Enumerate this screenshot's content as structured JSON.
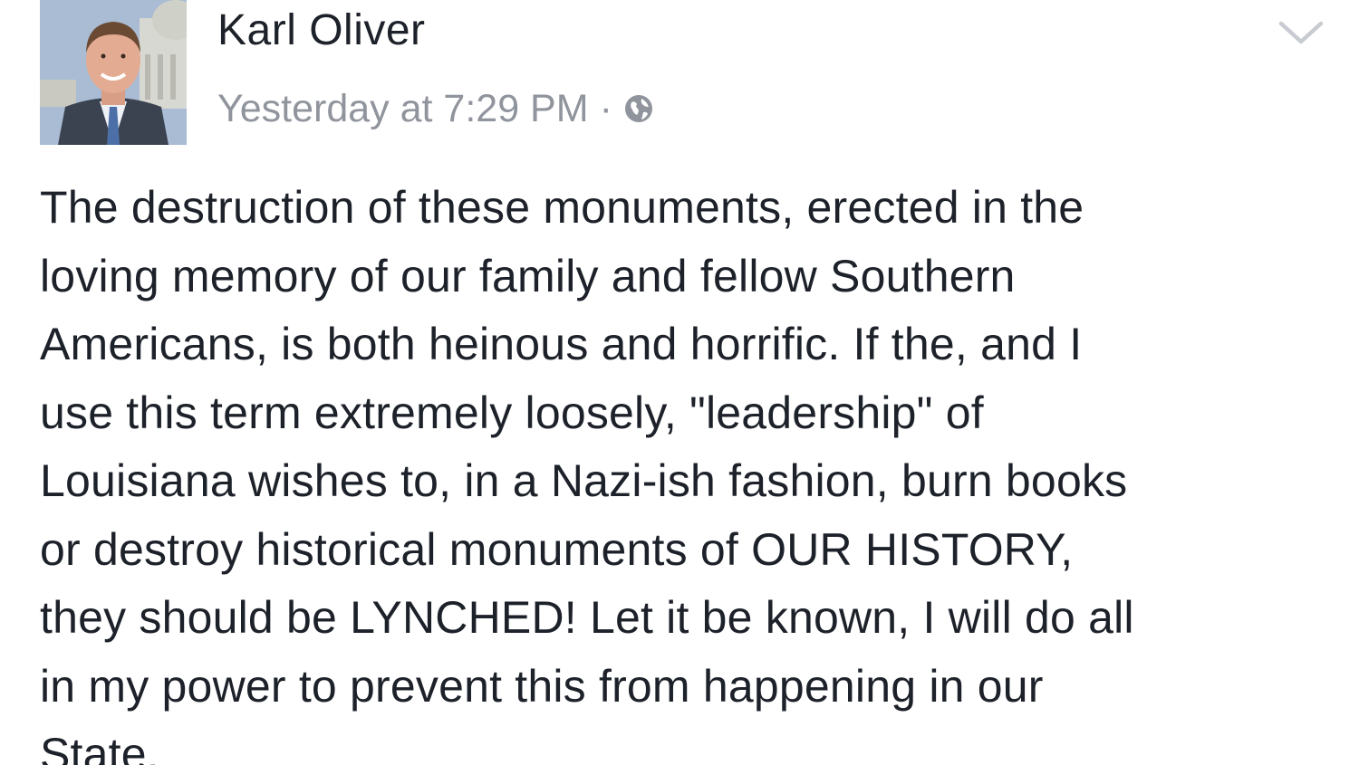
{
  "post": {
    "author": "Karl Oliver",
    "timestamp": "Yesterday at 7:29 PM",
    "separator": "·",
    "privacy_icon": "globe-icon",
    "menu_icon": "chevron-down-icon",
    "text": "The destruction of these monuments, erected in the\nloving memory of our family and fellow Southern\nAmericans, is both heinous and horrific. If the, and I\nuse this term extremely loosely, \"leadership\" of\nLouisiana wishes to, in a Nazi-ish fashion, burn books\nor  destroy historical monuments of OUR HISTORY,\nthey should be LYNCHED!  Let it be known, I will do all\nin my power to prevent this from happening in our\nState."
  },
  "colors": {
    "text": "#1d2129",
    "meta_text": "#90949c",
    "background": "#ffffff"
  }
}
